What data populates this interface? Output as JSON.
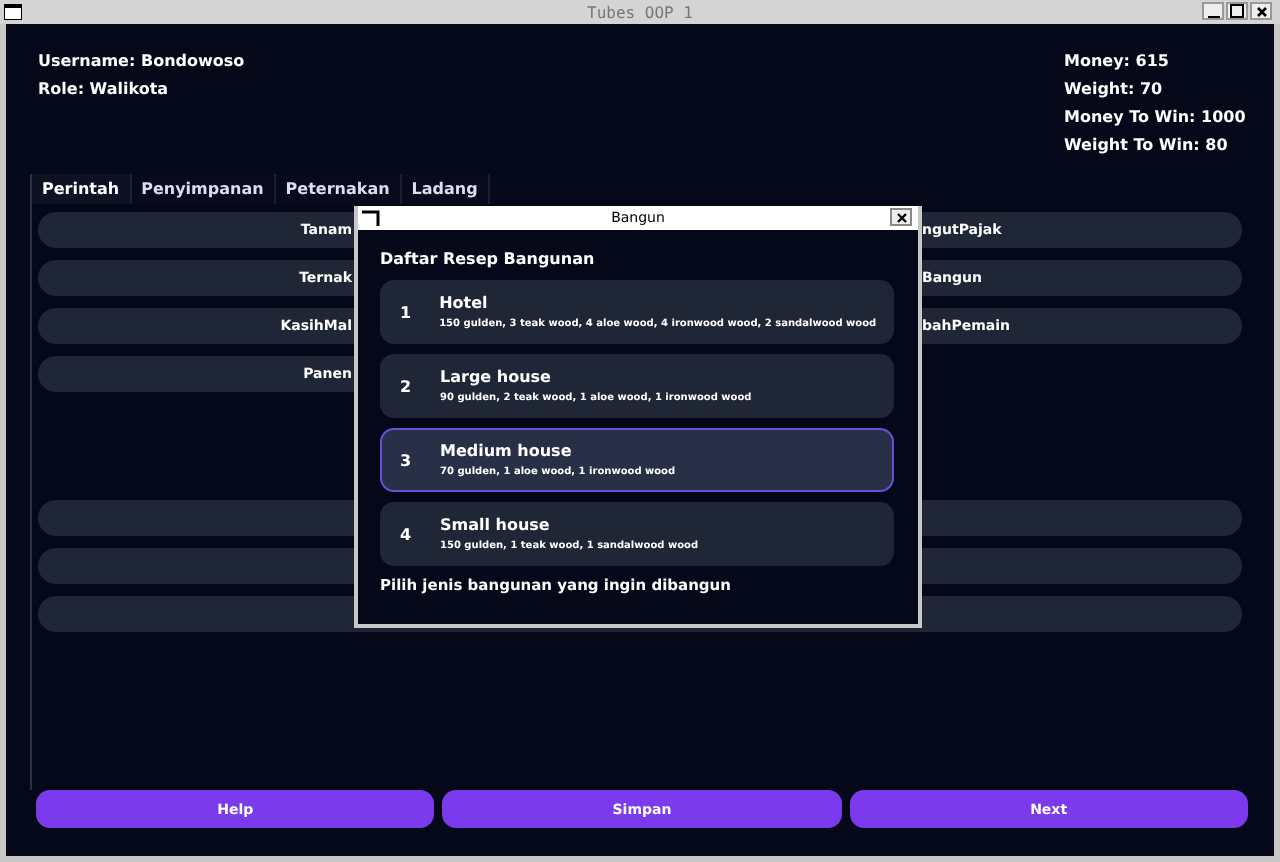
{
  "window": {
    "title": "Tubes OOP 1"
  },
  "player": {
    "username": "Username: Bondowoso",
    "role": "Role: Walikota"
  },
  "stats": [
    "Money: 615",
    "Weight: 70",
    "Money To Win: 1000",
    "Weight To Win: 80"
  ],
  "tabs": [
    {
      "label": "Perintah",
      "selected": true
    },
    {
      "label": "Penyimpanan",
      "selected": false
    },
    {
      "label": "Peternakan",
      "selected": false
    },
    {
      "label": "Ladang",
      "selected": false
    }
  ],
  "commands_left": [
    "Tanam",
    "Ternak",
    "KasihMal",
    "Panen"
  ],
  "commands_right": [
    "ngutPajak",
    "Bangun",
    "bahPemain"
  ],
  "footer_buttons": [
    "Help",
    "Simpan",
    "Next"
  ],
  "dialog": {
    "title": "Bangun",
    "heading": "Daftar Resep Bangunan",
    "recipes": [
      {
        "number": "1",
        "name": "Hotel",
        "cost": "150 gulden, 3 teak wood, 4 aloe wood, 4 ironwood wood, 2 sandalwood wood",
        "selected": false
      },
      {
        "number": "2",
        "name": "Large house",
        "cost": "90 gulden, 2 teak wood, 1 aloe wood, 1 ironwood wood",
        "selected": false
      },
      {
        "number": "3",
        "name": "Medium house",
        "cost": "70 gulden, 1 aloe wood, 1 ironwood wood",
        "selected": true
      },
      {
        "number": "4",
        "name": "Small house",
        "cost": "150 gulden, 1 teak wood, 1 sandalwood wood",
        "selected": false
      }
    ],
    "prompt": "Pilih jenis bangunan yang ingin dibangun"
  }
}
